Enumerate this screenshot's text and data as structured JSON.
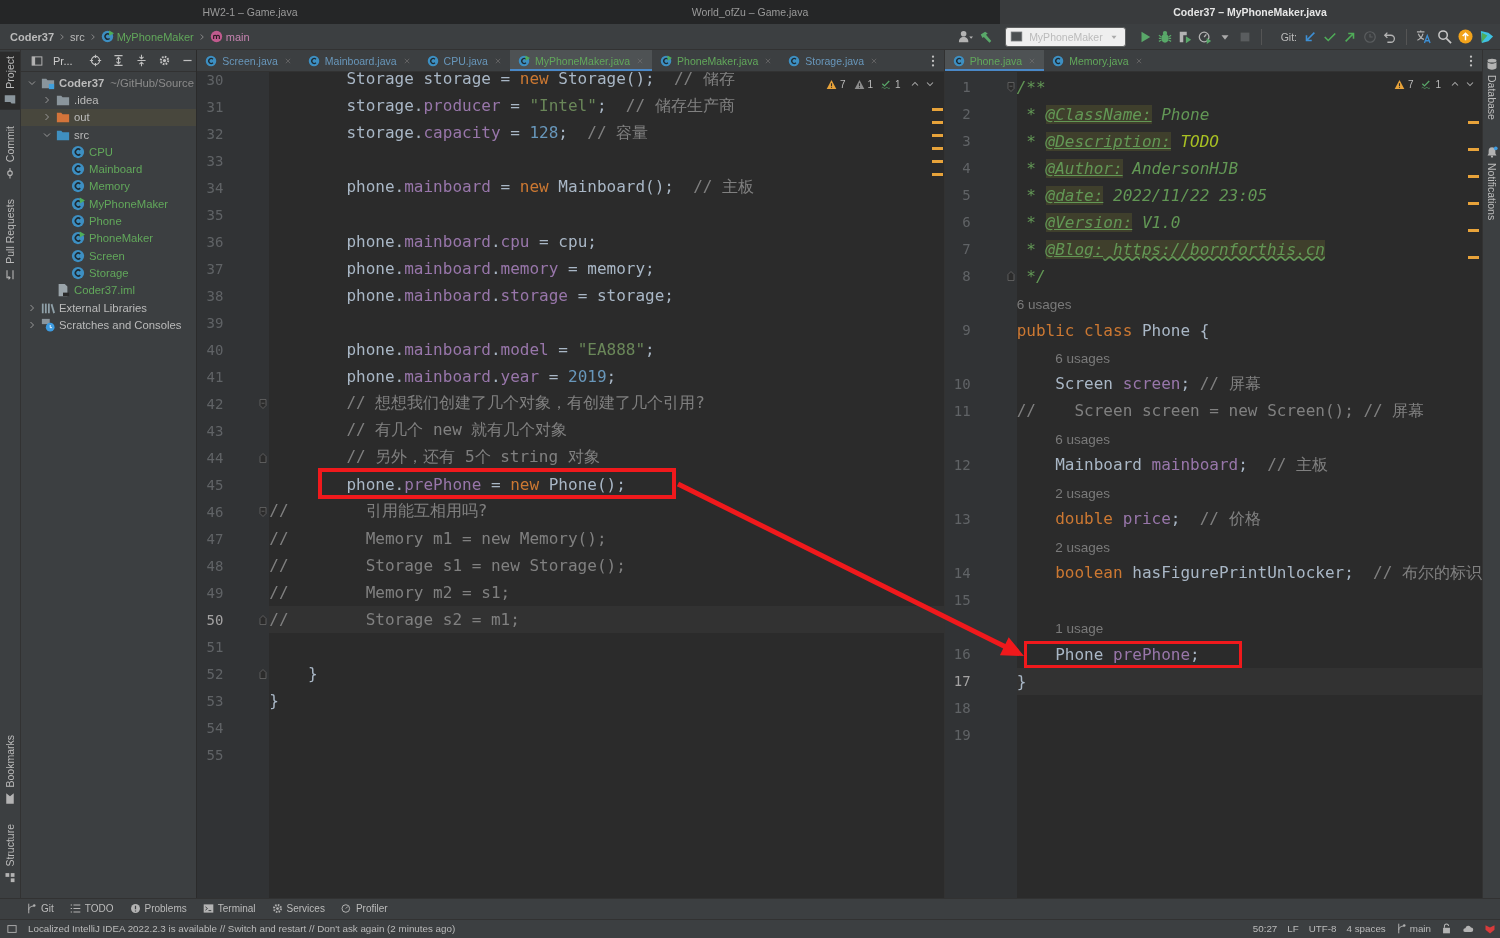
{
  "window_tabs": [
    {
      "title": "HW2-1 – Game.java",
      "selected": false
    },
    {
      "title": "World_ofZu – Game.java",
      "selected": false
    },
    {
      "title": "Coder37 – MyPhoneMaker.java",
      "selected": true
    }
  ],
  "breadcrumb": [
    {
      "label": "Coder37",
      "kind": "project",
      "added": false
    },
    {
      "label": "src",
      "kind": "folder",
      "added": false
    },
    {
      "label": "MyPhoneMaker",
      "kind": "main-class",
      "added": true
    },
    {
      "label": "main",
      "kind": "method",
      "added": false
    }
  ],
  "toolbar": {
    "run_configuration": "MyPhoneMaker",
    "git_label": "Git:"
  },
  "left_stripe": {
    "top": [
      {
        "label": "Project",
        "kind": "project",
        "selected": true
      },
      {
        "label": "Commit",
        "kind": "commit",
        "selected": false
      },
      {
        "label": "Pull Requests",
        "kind": "pull-requests",
        "selected": false
      }
    ],
    "bottom": [
      {
        "label": "Bookmarks",
        "kind": "bookmarks",
        "selected": false
      },
      {
        "label": "Structure",
        "kind": "structure",
        "selected": false
      }
    ]
  },
  "project": {
    "title": "Pr...",
    "tree": [
      {
        "label": "Coder37",
        "hint": "~/GitHub/Source",
        "kind": "module",
        "expanded": true,
        "selected": false,
        "added": false,
        "children": [
          {
            "label": ".idea",
            "kind": "folder",
            "expanded": false,
            "selected": false,
            "added": false
          },
          {
            "label": "out",
            "kind": "excluded-folder",
            "expanded": false,
            "selected": true,
            "added": false
          },
          {
            "label": "src",
            "kind": "source-folder",
            "expanded": true,
            "selected": false,
            "added": false,
            "children": [
              {
                "label": "CPU",
                "kind": "class",
                "selected": false,
                "added": true
              },
              {
                "label": "Mainboard",
                "kind": "class",
                "selected": false,
                "added": true
              },
              {
                "label": "Memory",
                "kind": "class",
                "selected": false,
                "added": true
              },
              {
                "label": "MyPhoneMaker",
                "kind": "main-class",
                "selected": false,
                "added": true
              },
              {
                "label": "Phone",
                "kind": "class",
                "selected": false,
                "added": true
              },
              {
                "label": "PhoneMaker",
                "kind": "main-class",
                "selected": false,
                "added": true
              },
              {
                "label": "Screen",
                "kind": "class",
                "selected": false,
                "added": true
              },
              {
                "label": "Storage",
                "kind": "class",
                "selected": false,
                "added": true
              }
            ]
          },
          {
            "label": "Coder37.iml",
            "kind": "module-file",
            "selected": false,
            "added": true
          }
        ]
      },
      {
        "label": "External Libraries",
        "kind": "libraries",
        "expanded": false,
        "selected": false,
        "added": false
      },
      {
        "label": "Scratches and Consoles",
        "kind": "scratches",
        "expanded": false,
        "selected": false,
        "added": false
      }
    ]
  },
  "editors": [
    {
      "tabs": [
        {
          "label": "Screen.java",
          "kind": "class",
          "selected": false,
          "added": false
        },
        {
          "label": "Mainboard.java",
          "kind": "class",
          "selected": false,
          "added": false
        },
        {
          "label": "CPU.java",
          "kind": "class",
          "selected": false,
          "added": false
        },
        {
          "label": "MyPhoneMaker.java",
          "kind": "main-class",
          "selected": true,
          "added": true
        },
        {
          "label": "PhoneMaker.java",
          "kind": "main-class",
          "selected": false,
          "added": true
        },
        {
          "label": "Storage.java",
          "kind": "class",
          "selected": false,
          "added": false
        }
      ],
      "inspections": {
        "warnings": "7",
        "weak_warnings": "1",
        "typos": "1"
      },
      "lines": [
        {
          "kind": "code",
          "number": "30",
          "current": false,
          "segments": [
            {
              "kind": "plain",
              "text": "        Storage storage = "
            },
            {
              "kind": "keyword",
              "text": "new"
            },
            {
              "kind": "plain",
              "text": " Storage();  "
            },
            {
              "kind": "comment",
              "text": "// 储存"
            }
          ]
        },
        {
          "kind": "code",
          "number": "31",
          "current": false,
          "segments": [
            {
              "kind": "plain",
              "text": "        storage."
            },
            {
              "kind": "field",
              "text": "producer"
            },
            {
              "kind": "plain",
              "text": " = "
            },
            {
              "kind": "string",
              "text": "\"Intel\""
            },
            {
              "kind": "plain",
              "text": ";  "
            },
            {
              "kind": "comment",
              "text": "// 储存生产商"
            }
          ]
        },
        {
          "kind": "code",
          "number": "32",
          "current": false,
          "segments": [
            {
              "kind": "plain",
              "text": "        storage."
            },
            {
              "kind": "field",
              "text": "capacity"
            },
            {
              "kind": "plain",
              "text": " = "
            },
            {
              "kind": "number",
              "text": "128"
            },
            {
              "kind": "plain",
              "text": ";  "
            },
            {
              "kind": "comment",
              "text": "// 容量"
            }
          ]
        },
        {
          "kind": "code",
          "number": "33",
          "current": false
        },
        {
          "kind": "code",
          "number": "34",
          "current": false,
          "segments": [
            {
              "kind": "plain",
              "text": "        phone."
            },
            {
              "kind": "field",
              "text": "mainboard"
            },
            {
              "kind": "plain",
              "text": " = "
            },
            {
              "kind": "keyword",
              "text": "new"
            },
            {
              "kind": "plain",
              "text": " Mainboard();  "
            },
            {
              "kind": "comment",
              "text": "// 主板"
            }
          ]
        },
        {
          "kind": "code",
          "number": "35",
          "current": false
        },
        {
          "kind": "code",
          "number": "36",
          "current": false,
          "segments": [
            {
              "kind": "plain",
              "text": "        phone."
            },
            {
              "kind": "field",
              "text": "mainboard"
            },
            {
              "kind": "plain",
              "text": "."
            },
            {
              "kind": "field",
              "text": "cpu"
            },
            {
              "kind": "plain",
              "text": " = cpu;"
            }
          ]
        },
        {
          "kind": "code",
          "number": "37",
          "current": false,
          "segments": [
            {
              "kind": "plain",
              "text": "        phone."
            },
            {
              "kind": "field",
              "text": "mainboard"
            },
            {
              "kind": "plain",
              "text": "."
            },
            {
              "kind": "field",
              "text": "memory"
            },
            {
              "kind": "plain",
              "text": " = memory;"
            }
          ]
        },
        {
          "kind": "code",
          "number": "38",
          "current": false,
          "segments": [
            {
              "kind": "plain",
              "text": "        phone."
            },
            {
              "kind": "field",
              "text": "mainboard"
            },
            {
              "kind": "plain",
              "text": "."
            },
            {
              "kind": "field",
              "text": "storage"
            },
            {
              "kind": "plain",
              "text": " = storage;"
            }
          ]
        },
        {
          "kind": "code",
          "number": "39",
          "current": false
        },
        {
          "kind": "code",
          "number": "40",
          "current": false,
          "segments": [
            {
              "kind": "plain",
              "text": "        phone."
            },
            {
              "kind": "field",
              "text": "mainboard"
            },
            {
              "kind": "plain",
              "text": "."
            },
            {
              "kind": "field",
              "text": "model"
            },
            {
              "kind": "plain",
              "text": " = "
            },
            {
              "kind": "string",
              "text": "\"EA888\""
            },
            {
              "kind": "plain",
              "text": ";"
            }
          ]
        },
        {
          "kind": "code",
          "number": "41",
          "current": false,
          "segments": [
            {
              "kind": "plain",
              "text": "        phone."
            },
            {
              "kind": "field",
              "text": "mainboard"
            },
            {
              "kind": "plain",
              "text": "."
            },
            {
              "kind": "field",
              "text": "year"
            },
            {
              "kind": "plain",
              "text": " = "
            },
            {
              "kind": "number",
              "text": "2019"
            },
            {
              "kind": "plain",
              "text": ";"
            }
          ]
        },
        {
          "kind": "fold-start",
          "number": "42",
          "current": false,
          "segments": [
            {
              "kind": "comment",
              "text": "        // 想想我们创建了几个对象，有创建了几个引用?"
            }
          ]
        },
        {
          "kind": "code",
          "number": "43",
          "current": false,
          "segments": [
            {
              "kind": "comment",
              "text": "        // 有几个 new 就有几个对象"
            }
          ]
        },
        {
          "kind": "fold-end",
          "number": "44",
          "current": false,
          "segments": [
            {
              "kind": "comment",
              "text": "        // 另外，还有 5个 string 对象"
            }
          ]
        },
        {
          "kind": "code",
          "number": "45",
          "current": false,
          "segments": [
            {
              "kind": "plain",
              "text": "        phone."
            },
            {
              "kind": "field",
              "text": "prePhone"
            },
            {
              "kind": "plain",
              "text": " = "
            },
            {
              "kind": "keyword",
              "text": "new"
            },
            {
              "kind": "plain",
              "text": " Phone();"
            }
          ]
        },
        {
          "kind": "fold-start",
          "number": "46",
          "current": false,
          "segments": [
            {
              "kind": "comment",
              "text": "//        引用能互相用吗?"
            }
          ]
        },
        {
          "kind": "code",
          "number": "47",
          "current": false,
          "segments": [
            {
              "kind": "comment",
              "text": "//        Memory m1 = new Memory();"
            }
          ]
        },
        {
          "kind": "code",
          "number": "48",
          "current": false,
          "segments": [
            {
              "kind": "comment",
              "text": "//        Storage s1 = new Storage();"
            }
          ]
        },
        {
          "kind": "code",
          "number": "49",
          "current": false,
          "segments": [
            {
              "kind": "comment",
              "text": "//        Memory m2 = s1;"
            }
          ]
        },
        {
          "kind": "fold-end",
          "number": "50",
          "current": true,
          "segments": [
            {
              "kind": "comment",
              "text": "//        Storage s2 = m1;"
            }
          ]
        },
        {
          "kind": "code",
          "number": "51",
          "current": false
        },
        {
          "kind": "fold-end",
          "number": "52",
          "current": false,
          "segments": [
            {
              "kind": "plain",
              "text": "    }"
            }
          ]
        },
        {
          "kind": "code",
          "number": "53",
          "current": false,
          "segments": [
            {
              "kind": "plain",
              "text": "}"
            }
          ]
        },
        {
          "kind": "code",
          "number": "54",
          "current": false
        },
        {
          "kind": "code",
          "number": "55",
          "current": false
        }
      ]
    },
    {
      "tabs": [
        {
          "label": "Phone.java",
          "kind": "class",
          "selected": true,
          "added": true
        },
        {
          "label": "Memory.java",
          "kind": "class",
          "selected": false,
          "added": true
        }
      ],
      "inspections": {
        "warnings": "7",
        "typos": "1"
      },
      "lines": [
        {
          "kind": "fold-start",
          "number": "1",
          "current": false,
          "segments": [
            {
              "kind": "doc",
              "text": "/**"
            }
          ]
        },
        {
          "kind": "code",
          "number": "2",
          "current": false,
          "segments": [
            {
              "kind": "doc",
              "text": " * "
            },
            {
              "kind": "doctag",
              "text": "@ClassName:"
            },
            {
              "kind": "doc",
              "text": " Phone"
            }
          ]
        },
        {
          "kind": "code",
          "number": "3",
          "current": false,
          "segments": [
            {
              "kind": "doc",
              "text": " * "
            },
            {
              "kind": "doctag",
              "text": "@Description:"
            },
            {
              "kind": "todo",
              "text": " TODO"
            }
          ]
        },
        {
          "kind": "code",
          "number": "4",
          "current": false,
          "segments": [
            {
              "kind": "doc",
              "text": " * "
            },
            {
              "kind": "doctag",
              "text": "@Author:"
            },
            {
              "kind": "doc",
              "text": " AndersonHJB"
            }
          ]
        },
        {
          "kind": "code",
          "number": "5",
          "current": false,
          "segments": [
            {
              "kind": "doc",
              "text": " * "
            },
            {
              "kind": "doctag",
              "text": "@date:"
            },
            {
              "kind": "doc",
              "text": " 2022/11/22 23:05"
            }
          ]
        },
        {
          "kind": "code",
          "number": "6",
          "current": false,
          "segments": [
            {
              "kind": "doc",
              "text": " * "
            },
            {
              "kind": "doctag",
              "text": "@Version:"
            },
            {
              "kind": "doc",
              "text": " V1.0"
            }
          ]
        },
        {
          "kind": "code",
          "number": "7",
          "current": false,
          "segments": [
            {
              "kind": "doc",
              "text": " * "
            },
            {
              "kind": "doctag",
              "text": "@Blog:"
            },
            {
              "kind": "link",
              "text": " https://bornforthis.cn"
            }
          ]
        },
        {
          "kind": "fold-end",
          "number": "8",
          "current": false,
          "segments": [
            {
              "kind": "doc",
              "text": " */"
            }
          ]
        },
        {
          "kind": "inlay",
          "text": "6 usages"
        },
        {
          "kind": "code",
          "number": "9",
          "current": false,
          "segments": [
            {
              "kind": "keyword",
              "text": "public class"
            },
            {
              "kind": "plain",
              "text": " Phone {"
            }
          ]
        },
        {
          "kind": "inlay",
          "text": "6 usages"
        },
        {
          "kind": "code",
          "number": "10",
          "current": false,
          "segments": [
            {
              "kind": "plain",
              "text": "    Screen "
            },
            {
              "kind": "field",
              "text": "screen"
            },
            {
              "kind": "plain",
              "text": "; "
            },
            {
              "kind": "comment",
              "text": "// 屏幕"
            }
          ]
        },
        {
          "kind": "code",
          "number": "11",
          "current": false,
          "segments": [
            {
              "kind": "comment",
              "text": "//    Screen screen = new Screen(); // 屏幕"
            }
          ]
        },
        {
          "kind": "inlay",
          "text": "6 usages"
        },
        {
          "kind": "code",
          "number": "12",
          "current": false,
          "segments": [
            {
              "kind": "plain",
              "text": "    Mainboard "
            },
            {
              "kind": "field",
              "text": "mainboard"
            },
            {
              "kind": "plain",
              "text": ";  "
            },
            {
              "kind": "comment",
              "text": "// 主板"
            }
          ]
        },
        {
          "kind": "inlay",
          "text": "2 usages"
        },
        {
          "kind": "code",
          "number": "13",
          "current": false,
          "segments": [
            {
              "kind": "keyword",
              "text": "    double"
            },
            {
              "kind": "field",
              "text": " price"
            },
            {
              "kind": "plain",
              "text": ";  "
            },
            {
              "kind": "comment",
              "text": "// 价格"
            }
          ]
        },
        {
          "kind": "inlay",
          "text": "2 usages"
        },
        {
          "kind": "code",
          "number": "14",
          "current": false,
          "segments": [
            {
              "kind": "keyword",
              "text": "    boolean"
            },
            {
              "kind": "plain",
              "text": " hasFigurePrintUnlocker;  "
            },
            {
              "kind": "comment",
              "text": "// 布尔的标识"
            }
          ]
        },
        {
          "kind": "code",
          "number": "15",
          "current": false
        },
        {
          "kind": "inlay",
          "text": "1 usage"
        },
        {
          "kind": "code",
          "number": "16",
          "current": false,
          "segments": [
            {
              "kind": "plain",
              "text": "    Phone "
            },
            {
              "kind": "field",
              "text": "prePhone"
            },
            {
              "kind": "plain",
              "text": ";"
            }
          ]
        },
        {
          "kind": "code",
          "number": "17",
          "current": true,
          "segments": [
            {
              "kind": "plain",
              "text": "}"
            }
          ]
        },
        {
          "kind": "code",
          "number": "18",
          "current": false
        },
        {
          "kind": "code",
          "number": "19",
          "current": false
        }
      ]
    }
  ],
  "right_stripe": [
    {
      "label": "Database",
      "kind": "database",
      "selected": false
    },
    {
      "label": "Notifications",
      "kind": "notifications",
      "selected": false
    }
  ],
  "tool_windows": [
    {
      "label": "Git",
      "kind": "git"
    },
    {
      "label": "TODO",
      "kind": "todo"
    },
    {
      "label": "Problems",
      "kind": "problems"
    },
    {
      "label": "Terminal",
      "kind": "terminal"
    },
    {
      "label": "Services",
      "kind": "services"
    },
    {
      "label": "Profiler",
      "kind": "profiler"
    }
  ],
  "status_bar": {
    "message": "Localized IntelliJ IDEA 2022.2.3 is available // Switch and restart // Don't ask again (2 minutes ago)",
    "position": "50:27",
    "line_separator": "LF",
    "encoding": "UTF-8",
    "indent": "4 spaces",
    "branch": "main"
  }
}
